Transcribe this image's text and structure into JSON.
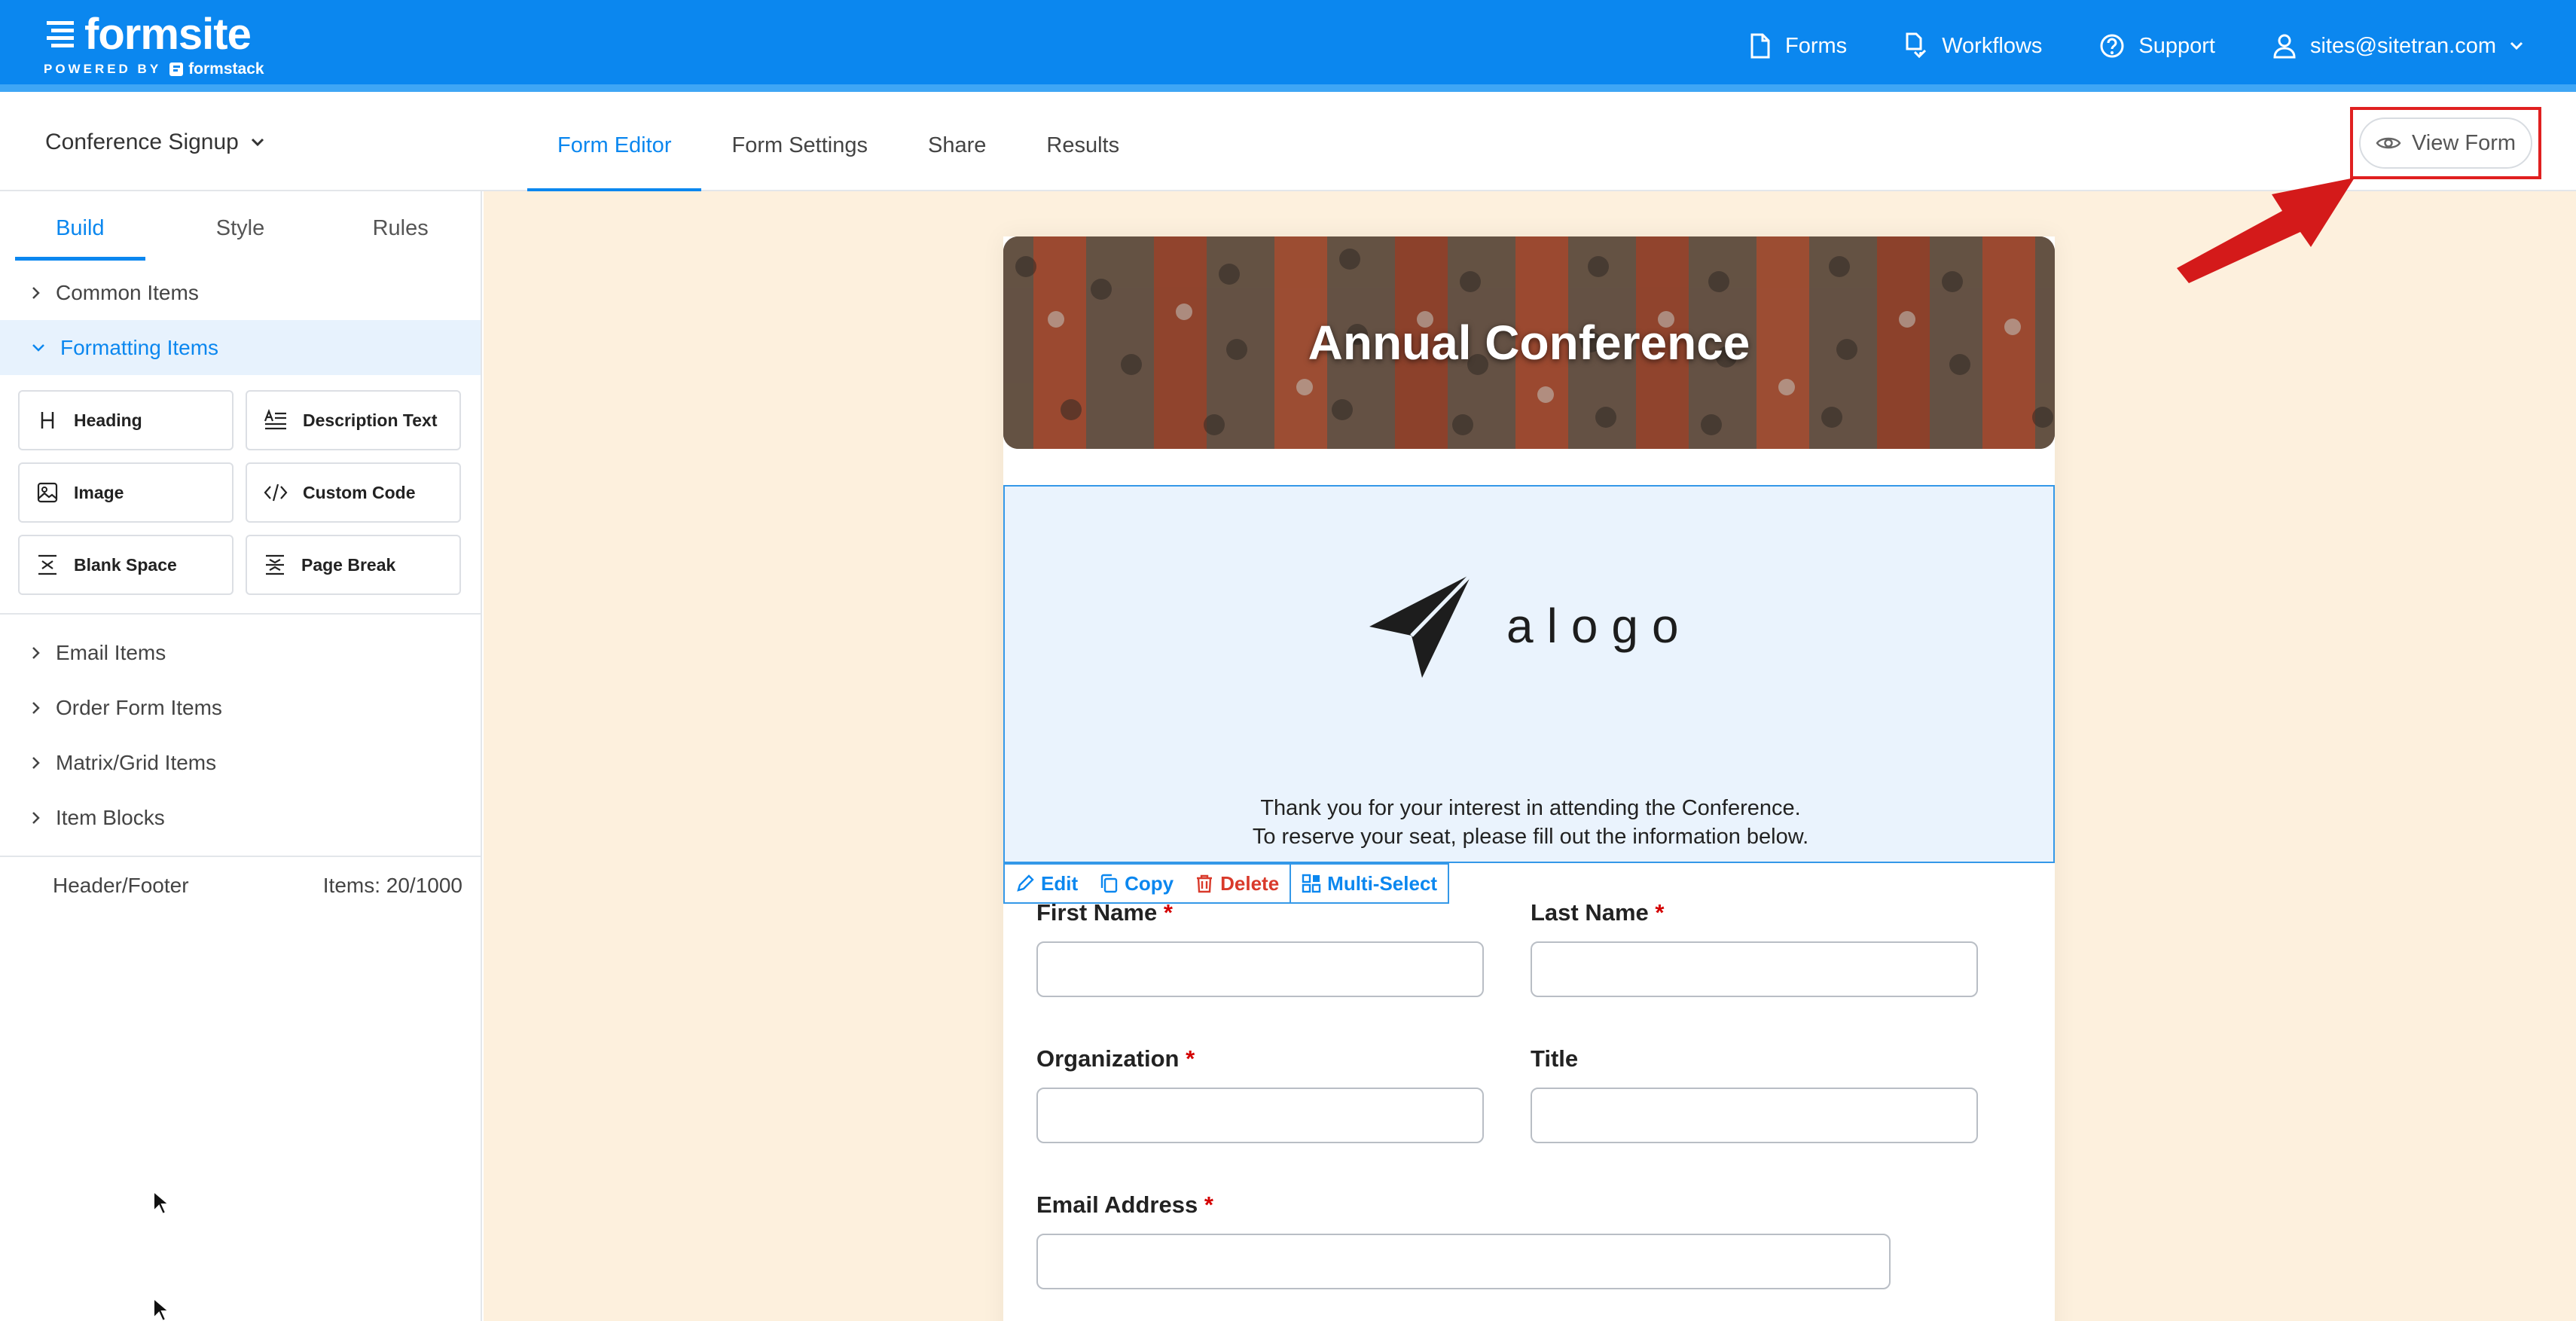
{
  "header": {
    "logo": {
      "name": "formsite",
      "powered_by": "POWERED BY",
      "partner": "formstack"
    },
    "nav": [
      {
        "label": "Forms",
        "icon": "document-icon"
      },
      {
        "label": "Workflows",
        "icon": "workflow-icon"
      },
      {
        "label": "Support",
        "icon": "help-circle-icon"
      },
      {
        "label": "sites@sitetran.com",
        "icon": "user-icon"
      }
    ]
  },
  "subbar": {
    "form_name": "Conference Signup",
    "tabs": [
      "Form Editor",
      "Form Settings",
      "Share",
      "Results"
    ],
    "active_tab": "Form Editor",
    "view_form_label": "View Form"
  },
  "sidebar": {
    "tabs": [
      "Build",
      "Style",
      "Rules"
    ],
    "active_tab": "Build",
    "sections_top": [
      {
        "label": "Common Items",
        "open": false
      },
      {
        "label": "Formatting Items",
        "open": true
      }
    ],
    "formatting_items": [
      {
        "label": "Heading",
        "icon": "heading-icon"
      },
      {
        "label": "Description Text",
        "icon": "description-text-icon"
      },
      {
        "label": "Image",
        "icon": "image-icon"
      },
      {
        "label": "Custom Code",
        "icon": "code-icon"
      },
      {
        "label": "Blank Space",
        "icon": "blank-space-icon"
      },
      {
        "label": "Page Break",
        "icon": "page-break-icon"
      }
    ],
    "sections_bottom": [
      "Email Items",
      "Order Form Items",
      "Matrix/Grid Items",
      "Item Blocks"
    ],
    "footer": {
      "left": "Header/Footer",
      "right": "Items: 20/1000"
    }
  },
  "form": {
    "banner_title": "Annual Conference",
    "logo_text": "alogo",
    "intro_line1": "Thank you for your interest in attending the Conference.",
    "intro_line2": "To reserve your seat, please fill out the information below.",
    "toolbar": {
      "edit": "Edit",
      "copy": "Copy",
      "delete": "Delete",
      "multi_select": "Multi-Select"
    },
    "fields": {
      "first_name": {
        "label": "First Name",
        "required": "*",
        "value": ""
      },
      "last_name": {
        "label": "Last Name",
        "required": "*",
        "value": ""
      },
      "organization": {
        "label": "Organization",
        "required": "*",
        "value": ""
      },
      "title": {
        "label": "Title",
        "value": ""
      },
      "email": {
        "label": "Email Address",
        "required": "*",
        "value": ""
      }
    }
  },
  "colors": {
    "brand_blue": "#0b87ef",
    "canvas_bg": "#fdf0dd",
    "annotation_red": "#e02020",
    "required_red": "#d40000"
  }
}
